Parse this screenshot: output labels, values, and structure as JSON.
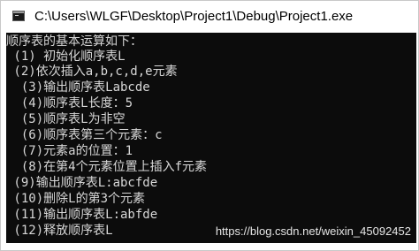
{
  "window": {
    "title": "C:\\Users\\WLGF\\Desktop\\Project1\\Debug\\Project1.exe"
  },
  "console": {
    "lines": [
      "顺序表的基本运算如下：",
      " (1) 初始化顺序表L",
      " (2)依次插入a,b,c,d,e元素",
      "  (3)输出顺序表Labcde",
      "  (4)顺序表L长度：5",
      "  (5)顺序表L为非空",
      "  (6)顺序表第三个元素：c",
      "  (7)元素a的位置：1",
      "  (8)在第4个元素位置上插入f元素",
      " (9)输出顺序表L:abcfde",
      " (10)删除L的第3个元素",
      " (11)输出顺序表L:abfde",
      " (12)释放顺序表L"
    ]
  },
  "watermark": "https://blog.csdn.net/weixin_45092452"
}
